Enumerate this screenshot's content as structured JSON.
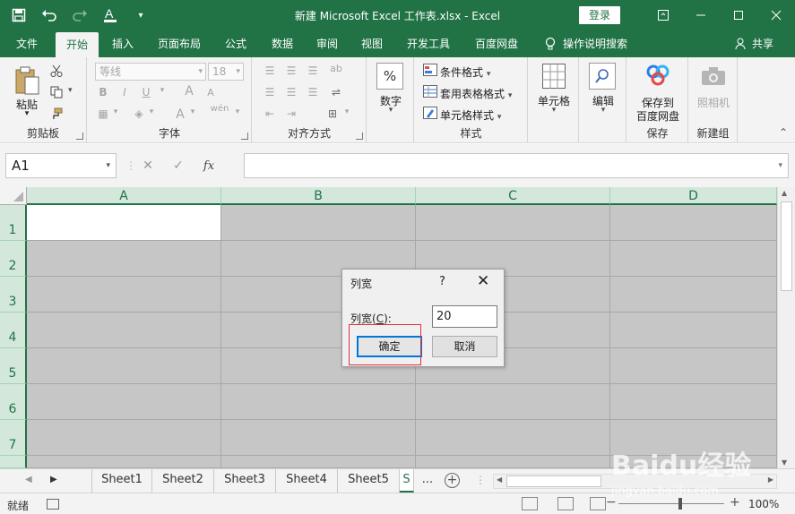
{
  "window": {
    "title": "新建 Microsoft Excel 工作表.xlsx  -  Excel",
    "login_label": "登录",
    "qat": {
      "save_icon": "save-icon",
      "undo_icon": "undo-icon",
      "redo_icon": "redo-icon",
      "font_color_icon": "font-color-icon",
      "customize_icon": "chevron-down-icon"
    }
  },
  "ribbon_tabs": [
    "文件",
    "开始",
    "插入",
    "页面布局",
    "公式",
    "数据",
    "审阅",
    "视图",
    "开发工具",
    "百度网盘"
  ],
  "active_tab": "开始",
  "tell_me": "操作说明搜索",
  "share": "共享",
  "ribbon": {
    "clipboard": {
      "paste": "粘贴",
      "label": "剪贴板"
    },
    "font": {
      "font_name": "等线",
      "font_size": "18",
      "label": "字体",
      "bold": "B",
      "italic": "I",
      "underline": "U",
      "grow": "A",
      "shrink": "A",
      "font_color": "A",
      "phonetic": "wén"
    },
    "alignment": {
      "label": "对齐方式"
    },
    "number": {
      "symbol": "%",
      "label": "数字"
    },
    "styles": {
      "conditional": "条件格式",
      "table": "套用表格格式",
      "cell_styles": "单元格样式",
      "label": "样式"
    },
    "cells": {
      "label": "单元格"
    },
    "editing": {
      "label": "编辑"
    },
    "save": {
      "line1": "保存到",
      "line2": "百度网盘",
      "label": "保存"
    },
    "camera": {
      "label": "照相机"
    },
    "new_group": "新建组"
  },
  "formula_bar": {
    "name_box": "A1",
    "cancel": "✕",
    "enter": "✓",
    "fx": "fx",
    "value": ""
  },
  "grid": {
    "columns": [
      "A",
      "B",
      "C",
      "D"
    ],
    "rows": [
      "1",
      "2",
      "3",
      "4",
      "5",
      "6",
      "7"
    ]
  },
  "dialog": {
    "title": "列宽",
    "help": "?",
    "close": "✕",
    "field_label_prefix": "列宽(",
    "field_label_key": "C",
    "field_label_suffix": "):",
    "value": "20",
    "ok": "确定",
    "cancel": "取消"
  },
  "sheets": [
    "Sheet1",
    "Sheet2",
    "Sheet3",
    "Sheet4",
    "Sheet5",
    "S"
  ],
  "sheet_overflow": "...",
  "add_sheet": "+",
  "status": {
    "ready": "就绪",
    "zoom": "100%",
    "zoom_minus": "−",
    "zoom_plus": "+"
  },
  "watermark": {
    "big": "Baidu经验",
    "small": "jingyan.baidu.com"
  }
}
